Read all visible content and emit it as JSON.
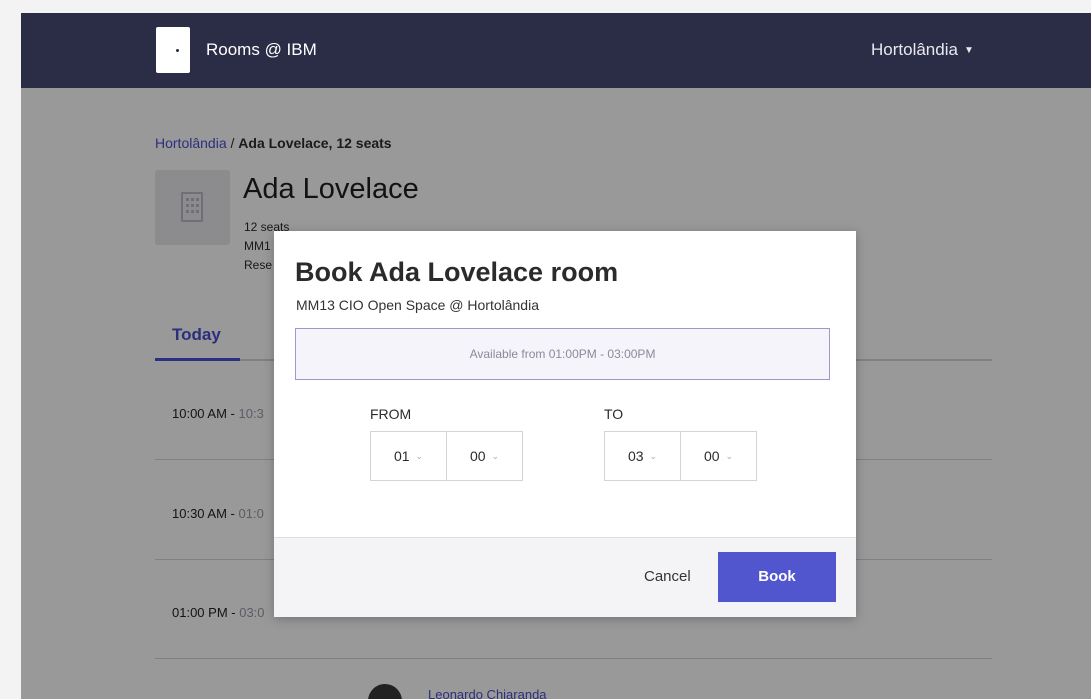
{
  "header": {
    "app_title": "Rooms @ IBM",
    "location": "Hortolândia"
  },
  "breadcrumb": {
    "parent": "Hortolândia",
    "separator": " / ",
    "current": "Ada Lovelace, 12 seats"
  },
  "room": {
    "name": "Ada Lovelace",
    "seats": "12 seats",
    "meta_line2": "MM1",
    "meta_line3": "Rese"
  },
  "tabs": [
    {
      "label": "Today"
    }
  ],
  "slots": [
    {
      "start": "10:00 AM",
      "separator": " - ",
      "end": "10:3"
    },
    {
      "start": "10:30 AM",
      "separator": " - ",
      "end": "01:0"
    },
    {
      "start": "01:00 PM",
      "separator": " - ",
      "end": "03:0"
    }
  ],
  "reservation": {
    "person": "Leonardo Chiaranda"
  },
  "modal": {
    "title": "Book Ada Lovelace room",
    "subtitle": "MM13 CIO Open Space @ Hortolândia",
    "availability": "Available from 01:00PM - 03:00PM",
    "from_label": "FROM",
    "to_label": "TO",
    "from_hour": "01",
    "from_minute": "00",
    "to_hour": "03",
    "to_minute": "00",
    "cancel_label": "Cancel",
    "book_label": "Book"
  },
  "colors": {
    "header_bg": "#2b2d47",
    "accent": "#5156cf",
    "link": "#4a4fd0"
  }
}
